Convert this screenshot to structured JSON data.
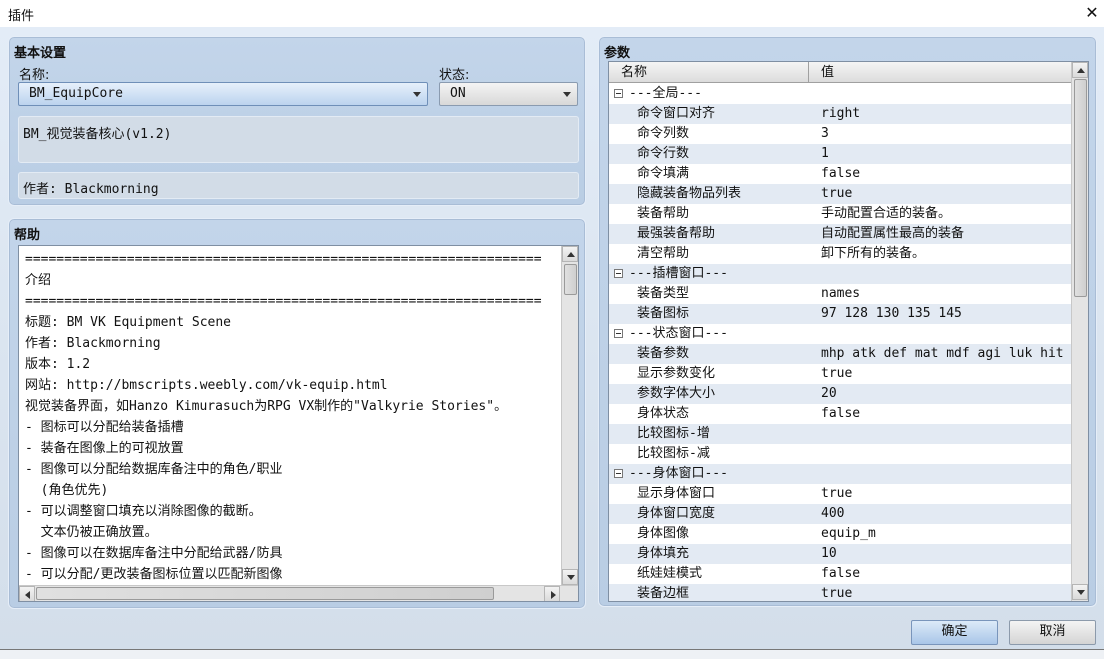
{
  "window": {
    "title": "插件",
    "close_icon": "close-icon"
  },
  "basic": {
    "title": "基本设置",
    "name_label": "名称:",
    "name_value": "BM_EquipCore",
    "status_label": "状态:",
    "status_value": "ON",
    "description": "BM_视觉装备核心(v1.2)",
    "author": "作者: Blackmorning"
  },
  "help": {
    "title": "帮助",
    "lines": [
      "==================================================================",
      "介绍",
      "==================================================================",
      "标题: BM VK Equipment Scene",
      "作者: Blackmorning",
      "版本: 1.2",
      "网站: http://bmscripts.weebly.com/vk-equip.html",
      "视觉装备界面，如Hanzo Kimurasuch为RPG VX制作的\"Valkyrie Stories\"。",
      "- 图标可以分配给装备插槽",
      "- 装备在图像上的可视放置",
      "- 图像可以分配给数据库备注中的角色/职业",
      "  (角色优先)",
      "- 可以调整窗口填充以消除图像的截断。",
      "  文本仍被正确放置。",
      "- 图像可以在数据库备注中分配给武器/防具",
      "- 可以分配/更改装备图标位置以匹配新图像"
    ]
  },
  "params": {
    "title": "参数",
    "col_name": "名称",
    "col_value": "值",
    "rows": [
      {
        "name": "---全局---",
        "value": "",
        "group": true
      },
      {
        "name": "命令窗口对齐",
        "value": "right"
      },
      {
        "name": "命令列数",
        "value": "3"
      },
      {
        "name": "命令行数",
        "value": "1"
      },
      {
        "name": "命令填满",
        "value": "false"
      },
      {
        "name": "隐藏装备物品列表",
        "value": "true"
      },
      {
        "name": "装备帮助",
        "value": "手动配置合适的装备。"
      },
      {
        "name": "最强装备帮助",
        "value": "自动配置属性最高的装备"
      },
      {
        "name": "清空帮助",
        "value": "卸下所有的装备。"
      },
      {
        "name": "---插槽窗口---",
        "value": "",
        "group": true
      },
      {
        "name": "装备类型",
        "value": "names"
      },
      {
        "name": "装备图标",
        "value": "97 128 130 135 145"
      },
      {
        "name": "---状态窗口---",
        "value": "",
        "group": true
      },
      {
        "name": "装备参数",
        "value": "mhp atk def mat mdf agi luk hit cri"
      },
      {
        "name": "显示参数变化",
        "value": "true"
      },
      {
        "name": "参数字体大小",
        "value": "20"
      },
      {
        "name": "身体状态",
        "value": "false"
      },
      {
        "name": "比较图标-增",
        "value": ""
      },
      {
        "name": "比较图标-减",
        "value": ""
      },
      {
        "name": "---身体窗口---",
        "value": "",
        "group": true
      },
      {
        "name": "显示身体窗口",
        "value": "true"
      },
      {
        "name": "身体窗口宽度",
        "value": "400"
      },
      {
        "name": "身体图像",
        "value": "equip_m"
      },
      {
        "name": "身体填充",
        "value": "10"
      },
      {
        "name": "纸娃娃模式",
        "value": "false"
      },
      {
        "name": "装备边框",
        "value": "true"
      }
    ]
  },
  "buttons": {
    "ok": "确定",
    "cancel": "取消"
  }
}
